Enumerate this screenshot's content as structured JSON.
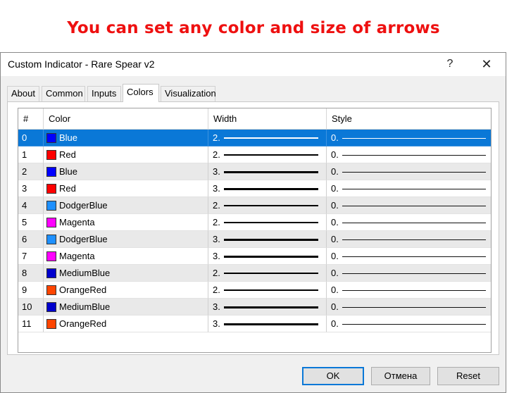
{
  "banner": "You can set any color and size of arrows",
  "window": {
    "title": "Custom Indicator - Rare Spear v2",
    "help_label": "?",
    "close_label": "✕"
  },
  "tabs": [
    {
      "label": "About"
    },
    {
      "label": "Common"
    },
    {
      "label": "Inputs"
    },
    {
      "label": "Colors",
      "active": true
    },
    {
      "label": "Visualization"
    }
  ],
  "table": {
    "headers": [
      "#",
      "Color",
      "Width",
      "Style"
    ],
    "rows": [
      {
        "index": "0",
        "color_name": "Blue",
        "color_hex": "#0000ff",
        "width": "2.",
        "style": "0.",
        "selected": true
      },
      {
        "index": "1",
        "color_name": "Red",
        "color_hex": "#ff0000",
        "width": "2.",
        "style": "0."
      },
      {
        "index": "2",
        "color_name": "Blue",
        "color_hex": "#0000ff",
        "width": "3.",
        "style": "0."
      },
      {
        "index": "3",
        "color_name": "Red",
        "color_hex": "#ff0000",
        "width": "3.",
        "style": "0."
      },
      {
        "index": "4",
        "color_name": "DodgerBlue",
        "color_hex": "#1e90ff",
        "width": "2.",
        "style": "0."
      },
      {
        "index": "5",
        "color_name": "Magenta",
        "color_hex": "#ff00ff",
        "width": "2.",
        "style": "0."
      },
      {
        "index": "6",
        "color_name": "DodgerBlue",
        "color_hex": "#1e90ff",
        "width": "3.",
        "style": "0."
      },
      {
        "index": "7",
        "color_name": "Magenta",
        "color_hex": "#ff00ff",
        "width": "3.",
        "style": "0."
      },
      {
        "index": "8",
        "color_name": "MediumBlue",
        "color_hex": "#0000cd",
        "width": "2.",
        "style": "0."
      },
      {
        "index": "9",
        "color_name": "OrangeRed",
        "color_hex": "#ff4500",
        "width": "2.",
        "style": "0."
      },
      {
        "index": "10",
        "color_name": "MediumBlue",
        "color_hex": "#0000cd",
        "width": "3.",
        "style": "0."
      },
      {
        "index": "11",
        "color_name": "OrangeRed",
        "color_hex": "#ff4500",
        "width": "3.",
        "style": "0."
      }
    ]
  },
  "buttons": {
    "ok": "OK",
    "cancel": "Отмена",
    "reset": "Reset"
  },
  "colors": {
    "banner_text": "#ee1010",
    "selection": "#0a78d7"
  }
}
